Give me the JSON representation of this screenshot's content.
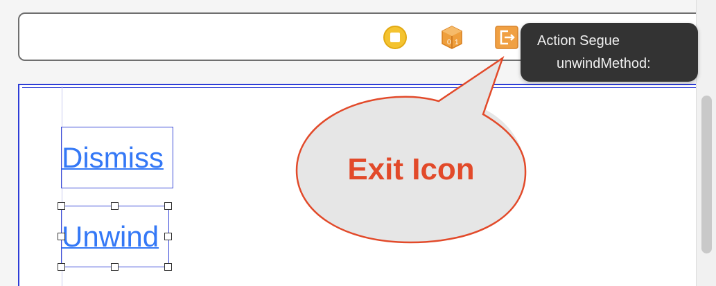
{
  "storyboard": {
    "buttons": {
      "dismiss_label": "Dismiss",
      "unwind_label": "Unwind"
    }
  },
  "dock": {
    "icons": [
      "first-responder-icon",
      "cube-icon",
      "exit-icon"
    ]
  },
  "tooltip": {
    "title": "Action Segue",
    "method": "unwindMethod:"
  },
  "callout": {
    "text": "Exit Icon"
  },
  "colors": {
    "selection_blue": "#2d3cd6",
    "button_text": "#3478f6",
    "callout_red": "#e24a2a",
    "callout_fill": "#e6e6e6",
    "exit_orange": "#f0a043",
    "first_responder_yellow": "#f2c12e",
    "tooltip_bg": "#333333"
  }
}
